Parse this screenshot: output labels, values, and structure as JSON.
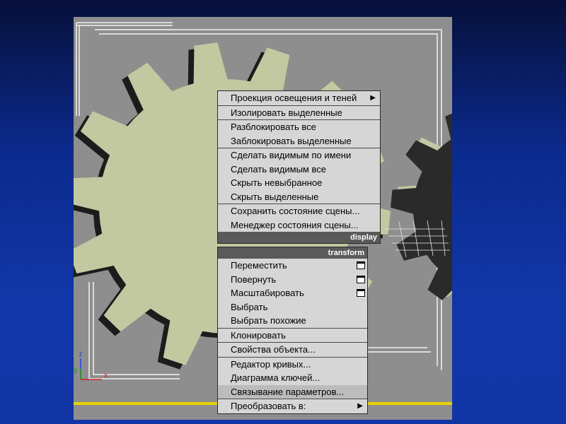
{
  "colors": {
    "background": "#1236a8",
    "viewport": "#8e8e8e",
    "gear": "#c2c8a0",
    "menu": "#d6d6d6",
    "quad_label": "#5a5a5a",
    "timeline": "#e8d200"
  },
  "axis_gizmo": {
    "z": "z",
    "y": "y",
    "x": "x"
  },
  "display_quad": {
    "label": "display",
    "items": [
      {
        "label": "Проекция освещения и теней",
        "submenu": true
      },
      {
        "label": "Изолировать выделенные"
      },
      {
        "label": "Разблокировать все"
      },
      {
        "label": "Заблокировать выделенные"
      },
      {
        "label": "Сделать видимым по имени"
      },
      {
        "label": "Сделать видимым все"
      },
      {
        "label": "Скрыть невыбранное"
      },
      {
        "label": "Скрыть выделенные"
      },
      {
        "label": "Сохранить состояние сцены..."
      },
      {
        "label": "Менеджер состояния сцены..."
      }
    ]
  },
  "transform_quad": {
    "label": "transform",
    "items": [
      {
        "label": "Переместить",
        "option_box": true
      },
      {
        "label": "Повернуть",
        "option_box": true
      },
      {
        "label": "Масштабировать",
        "option_box": true
      },
      {
        "label": "Выбрать"
      },
      {
        "label": "Выбрать похожие"
      },
      {
        "label": "Клонировать"
      },
      {
        "label": "Свойства объекта..."
      },
      {
        "label": "Редактор кривых..."
      },
      {
        "label": "Диаграмма ключей..."
      },
      {
        "label": "Связывание параметров...",
        "highlighted": true
      },
      {
        "label": "Преобразовать в:",
        "submenu": true
      }
    ]
  }
}
